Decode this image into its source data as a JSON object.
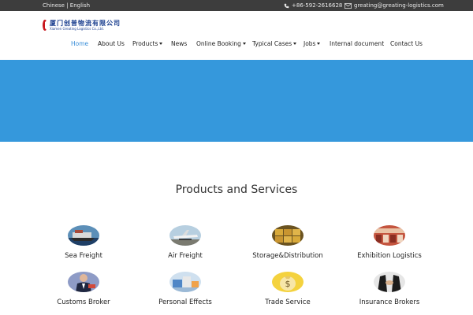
{
  "topbar": {
    "lang_chinese": "Chinese",
    "lang_sep": "|",
    "lang_english": "English",
    "phone": "+86-592-2616628",
    "email": "greating@greating-logistics.com"
  },
  "logo": {
    "cn": "厦门创普物流有限公司",
    "en": "Xiamen Greating Logistics Co.,Ltd."
  },
  "nav": {
    "items": [
      {
        "label": "Home",
        "active": true
      },
      {
        "label": "About Us"
      },
      {
        "label": "Products",
        "dropdown": true
      },
      {
        "label": "News"
      },
      {
        "label": "Online Booking",
        "dropdown": true
      },
      {
        "label": "Typical Cases",
        "dropdown": true
      },
      {
        "label": "Jobs",
        "dropdown": true
      },
      {
        "label": "Internal document"
      },
      {
        "label": "Contact Us"
      }
    ]
  },
  "colors": {
    "banner": "#3598dc",
    "topbar": "#3d3d3d",
    "nav_active": "#3a8fd9"
  },
  "section": {
    "title": "Products and Services"
  },
  "services": [
    {
      "label": "Sea Freight",
      "icon": "ship-photo-icon"
    },
    {
      "label": "Air Freight",
      "icon": "airplane-photo-icon"
    },
    {
      "label": "Storage&Distribution",
      "icon": "warehouse-photo-icon"
    },
    {
      "label": "Exhibition Logistics",
      "icon": "exhibition-photo-icon"
    },
    {
      "label": "Customs Broker",
      "icon": "businessman-photo-icon"
    },
    {
      "label": "Personal Effects",
      "icon": "moving-boxes-photo-icon"
    },
    {
      "label": "Trade Service",
      "icon": "dollar-bag-photo-icon"
    },
    {
      "label": "Insurance Brokers",
      "icon": "handshake-photo-icon"
    }
  ]
}
